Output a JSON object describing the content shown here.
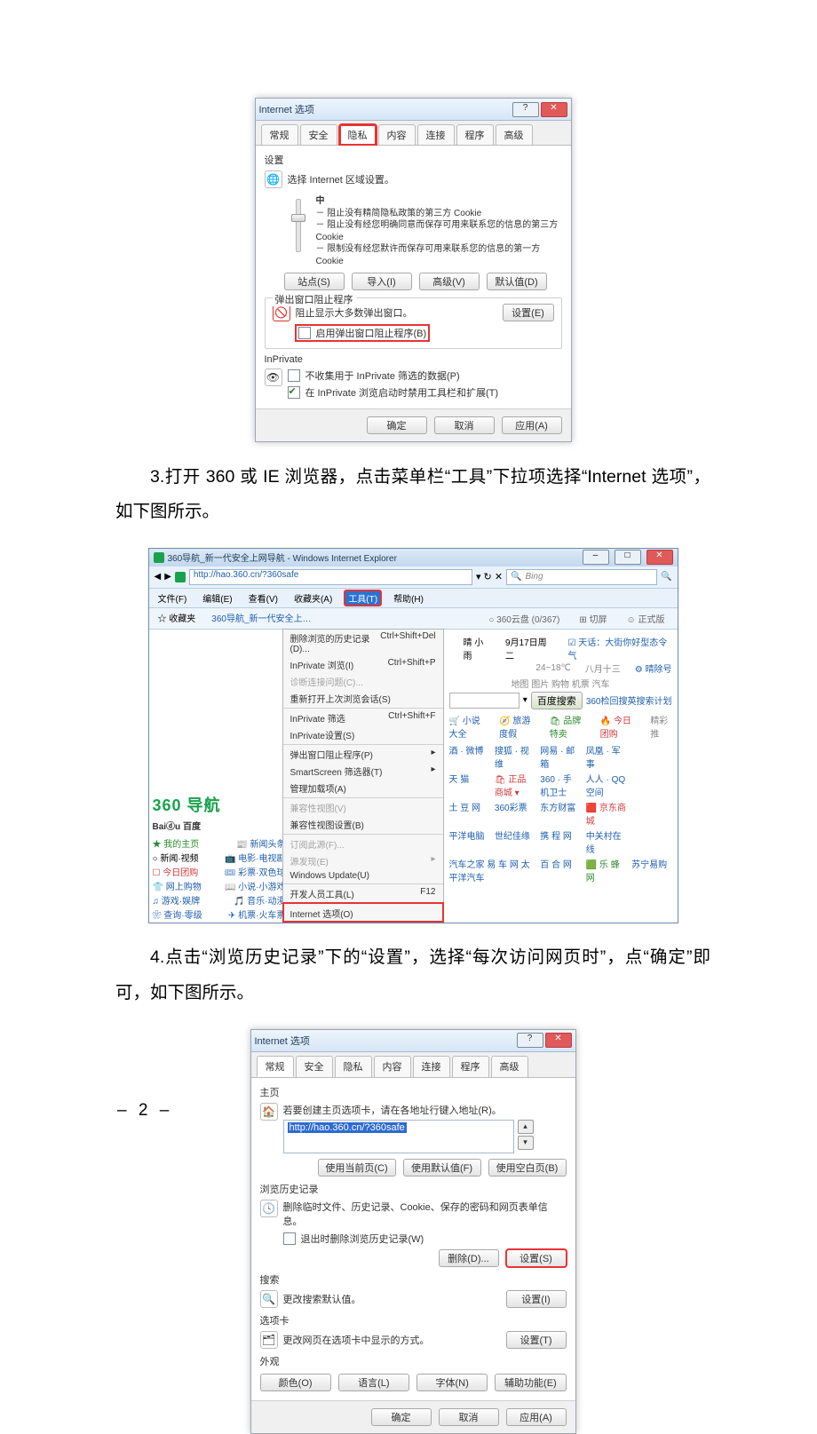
{
  "page": {
    "footer": "– 2 –"
  },
  "text": {
    "p3": "3.打开 360 或 IE 浏览器，点击菜单栏“工具”下拉项选择“Internet 选项”，如下图所示。",
    "p4": "4.点击“浏览历史记录”下的“设置”，选择“每次访问网页时”，点“确定”即可，如下图所示。"
  },
  "dlg1": {
    "title": "Internet 选项",
    "tabs": [
      "常规",
      "安全",
      "隐私",
      "内容",
      "连接",
      "程序",
      "高级"
    ],
    "settings_label": "设置",
    "select_zone": "选择 Internet 区域设置。",
    "level": "中",
    "bullets": [
      "－ 阻止没有精简隐私政策的第三方 Cookie",
      "－ 阻止没有经您明确同意而保存可用来联系您的信息的第三方 Cookie",
      "－ 限制没有经您默许而保存可用来联系您的信息的第一方 Cookie"
    ],
    "buttons_row": [
      "站点(S)",
      "导入(I)",
      "高级(V)",
      "默认值(D)"
    ],
    "popup_legend": "弹出窗口阻止程序",
    "popup_text": "阻止显示大多数弹出窗口。",
    "popup_setting_btn": "设置(E)",
    "popup_cb": "启用弹出窗口阻止程序(B)",
    "inprivate_legend": "InPrivate",
    "inpriv_cb1": "不收集用于 InPrivate 筛选的数据(P)",
    "inpriv_cb2": "在 InPrivate 浏览启动时禁用工具栏和扩展(T)",
    "ok": "确定",
    "cancel": "取消",
    "apply": "应用(A)"
  },
  "shot2": {
    "title": "360导航_新一代安全上网导航 - Windows Internet Explorer",
    "url": "http://hao.360.cn/?360safe",
    "bing": "Bing",
    "menubar": [
      "文件(F)",
      "编辑(E)",
      "查看(V)",
      "收藏夹(A)",
      "工具(T)",
      "帮助(H)"
    ],
    "bookbar": [
      "☆ 收藏夹",
      "360导航_新一代安全上…"
    ],
    "topbar_right": [
      "○ 360云盘 (0/367)",
      "⊞ 切屏",
      "☺ 正式版"
    ],
    "dropdown": [
      {
        "l": "删除浏览的历史记录(D)...",
        "r": "Ctrl+Shift+Del"
      },
      {
        "l": "InPrivate 浏览(I)",
        "r": "Ctrl+Shift+P"
      },
      {
        "l": "诊断连接问题(C)...",
        "r": ""
      },
      {
        "l": "重新打开上次浏览会话(S)",
        "r": ""
      },
      {
        "l": "InPrivate 筛选",
        "r": "Ctrl+Shift+F"
      },
      {
        "l": "InPrivate设置(S)",
        "r": ""
      },
      {
        "l": "弹出窗口阻止程序(P)",
        "r": "▸"
      },
      {
        "l": "SmartScreen 筛选器(T)",
        "r": "▸"
      },
      {
        "l": "管理加载项(A)",
        "r": ""
      },
      {
        "l": "兼容性视图(V)",
        "r": ""
      },
      {
        "l": "兼容性视图设置(B)",
        "r": ""
      },
      {
        "l": "订阅此源(F)...",
        "r": ""
      },
      {
        "l": "源发现(E)",
        "r": "▸"
      },
      {
        "l": "Windows Update(U)",
        "r": ""
      },
      {
        "l": "开发人员工具(L)",
        "r": "F12"
      },
      {
        "l": "Internet 选项(O)",
        "r": ""
      }
    ],
    "logo": "360 导航",
    "baidu": "Baiⓓu 百度",
    "weather": {
      "city": "晴 小雨",
      "temp": "24~18℃",
      "date": "9月17日周二",
      "lunar": "八月十三",
      "air": "☑ 天话：大街你好型态令气",
      "set": "⚙ 晴除号"
    },
    "search_tabs": "地图  图片  购物  机票  汽车",
    "search_btn": "百度搜索",
    "search_side": "360检回搜英搜索计划",
    "nav_left": [
      "★ 我的主页",
      "○ 新闻·视频",
      "☐ 今日团购",
      "👕 网上购物",
      "♫ 游戏·娱牌",
      "❀ 查询·零级"
    ],
    "nav_right": [
      "📰 新闻头条",
      "📺 电影·电视剧",
      "🎟 彩票·双色球",
      "📖 小说·小游戏",
      "🎵 音乐·动漫",
      "✈ 机票·火车票"
    ],
    "grid_headers": [
      "🛒 小说大全",
      "🧭 旅游度假",
      "🛍 品牌特卖",
      "🔥 今日团购",
      "精彩推"
    ],
    "grid": [
      [
        "酒 · 微博",
        "搜狐 · 视维",
        "网易 · 邮箱",
        "凤凰 · 军事"
      ],
      [
        "天 猫",
        "🛍 正品商城 ▾",
        "360 · 手机卫士",
        "人人 · QQ空间"
      ],
      [
        "土 豆 网",
        "360彩票",
        "东方财富",
        "🟥 京东商城"
      ],
      [
        "平洋电脑",
        "世纪佳缘",
        "携 程 网",
        "中关村在线"
      ],
      [
        "汽车之家    易 车 网    太平洋汽车",
        "百 合 网",
        "🟩 乐 蜂 网",
        "苏宁易购"
      ]
    ]
  },
  "dlg3": {
    "title": "Internet 选项",
    "tabs": [
      "常规",
      "安全",
      "隐私",
      "内容",
      "连接",
      "程序",
      "高级"
    ],
    "home_label": "主页",
    "home_text": "若要创建主页选项卡，请在各地址行键入地址(R)。",
    "home_url": "http://hao.360.cn/?360safe",
    "home_btns": [
      "使用当前页(C)",
      "使用默认值(F)",
      "使用空白页(B)"
    ],
    "hist_label": "浏览历史记录",
    "hist_text": "删除临时文件、历史记录、Cookie、保存的密码和网页表单信息。",
    "hist_cb": "退出时删除浏览历史记录(W)",
    "hist_btns": [
      "删除(D)...",
      "设置(S)"
    ],
    "search_label": "搜索",
    "search_text": "更改搜索默认值。",
    "search_btn": "设置(I)",
    "tabs2_label": "选项卡",
    "tabs2_text": "更改网页在选项卡中显示的方式。",
    "tabs2_btn": "设置(T)",
    "appearance_label": "外观",
    "appearance_btns": [
      "颜色(O)",
      "语言(L)",
      "字体(N)",
      "辅助功能(E)"
    ],
    "ok": "确定",
    "cancel": "取消",
    "apply": "应用(A)"
  }
}
